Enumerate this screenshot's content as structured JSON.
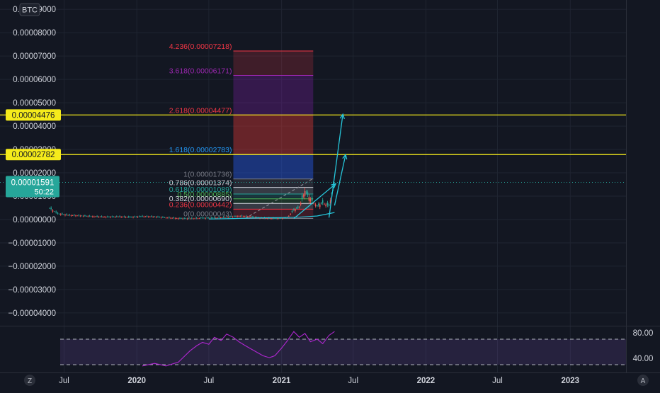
{
  "symbol_badge": "BTC",
  "theme": {
    "background": "#131722",
    "grid": "#1f2431",
    "axis_text": "#d1d4dc",
    "badge_yellow": "#f5eb1b",
    "badge_teal": "#26a69a",
    "rsi_purple": "#b026d1",
    "rsi_band": "#7e57c2",
    "projection": "#26c6da",
    "candle_up": "#26a69a",
    "candle_down": "#ef5350"
  },
  "price_axis": {
    "ticks": [
      "0.00009000",
      "0.00008000",
      "0.00007000",
      "0.00006000",
      "0.00005000",
      "0.00004000",
      "0.00003000",
      "0.00002000",
      "0.00001000",
      "0.00000000",
      "−0.00001000",
      "−0.00002000",
      "−0.00003000",
      "−0.00004000"
    ],
    "tick_values": [
      9e-05,
      8e-05,
      7e-05,
      6e-05,
      5e-05,
      4e-05,
      3e-05,
      2e-05,
      1e-05,
      0,
      -1e-05,
      -2e-05,
      -3e-05,
      -4e-05
    ],
    "badges": [
      {
        "label": "0.00004476",
        "value": 4.476e-05,
        "color": "#f5eb1b",
        "text_color": "#131722"
      },
      {
        "label": "0.00002782",
        "value": 2.782e-05,
        "color": "#f5eb1b",
        "text_color": "#131722"
      }
    ],
    "last_price": {
      "label": "0.00001591",
      "countdown": "50:22",
      "value": 1.591e-05,
      "color": "#26a69a"
    }
  },
  "time_axis": {
    "labels": [
      "Jul",
      "2020",
      "Jul",
      "2021",
      "Jul",
      "2022",
      "Jul",
      "2023"
    ],
    "bold": [
      false,
      true,
      false,
      true,
      false,
      true,
      false,
      true
    ]
  },
  "fib_levels": [
    {
      "label": "4.236(0.00007218)",
      "value": 7.218e-05,
      "color": "#f23645"
    },
    {
      "label": "3.618(0.00006171)",
      "value": 6.171e-05,
      "color": "#9c27b0"
    },
    {
      "label": "2.618(0.00004477)",
      "value": 4.477e-05,
      "color": "#f23645"
    },
    {
      "label": "1.618(0.00002783)",
      "value": 2.783e-05,
      "color": "#2196f3"
    },
    {
      "label": "1(0.00001736)",
      "value": 1.736e-05,
      "color": "#787b86"
    },
    {
      "label": "0.786(0.00001374)",
      "value": 1.374e-05,
      "color": "#d1d4dc"
    },
    {
      "label": "0.618(0.00001089)",
      "value": 1.089e-05,
      "color": "#26a69a"
    },
    {
      "label": "0.5(0.00000885)",
      "value": 8.85e-06,
      "color": "#4caf50"
    },
    {
      "label": "0.382(0.00000690)",
      "value": 6.9e-06,
      "color": "#d1d4dc"
    },
    {
      "label": "0.236(0.00000442)",
      "value": 4.42e-06,
      "color": "#f23645"
    },
    {
      "label": "0(0.00000043)",
      "value": 4.3e-07,
      "color": "#787b86"
    }
  ],
  "rsi": {
    "labels": [
      "80.00",
      "40.00"
    ],
    "label_values": [
      80,
      40
    ],
    "band_upper": 70,
    "band_lower": 30
  },
  "bottom_left_button": "Z",
  "bottom_right_button": "A",
  "chart_data": {
    "type": "line",
    "title": "",
    "ylim": [
      -4.55e-05,
      9.4e-05
    ],
    "grid": true,
    "x_timeline": [
      "2019-04",
      "2019-07",
      "2019-10",
      "2020-01",
      "2020-04",
      "2020-07",
      "2020-10",
      "2021-01",
      "2021-04",
      "2021-07",
      "2021-10",
      "2022-01",
      "2022-04",
      "2022-07",
      "2022-10",
      "2023-01"
    ],
    "series": [
      {
        "x": [
          "2019-05-25",
          "2019-06-15",
          "2019-07-15",
          "2019-08-15",
          "2019-09-15",
          "2019-10-15",
          "2019-11-15",
          "2019-12-15",
          "2020-01-15",
          "2020-02-15",
          "2020-03-15",
          "2020-04-15",
          "2020-05-15",
          "2020-06-15",
          "2020-07-15",
          "2020-08-15",
          "2020-09-15",
          "2020-10-15",
          "2020-11-15",
          "2020-12-15",
          "2021-01-15",
          "2021-02-01",
          "2021-02-15",
          "2021-03-01",
          "2021-03-15",
          "2021-04-01",
          "2021-04-15",
          "2021-05-01",
          "2021-05-15"
        ],
        "y": [
          4.9e-06,
          2.5e-06,
          1.8e-06,
          1.6e-06,
          1.3e-06,
          1.1e-06,
          1.2e-06,
          1e-06,
          1.3e-06,
          1.2e-06,
          8e-07,
          5e-07,
          4e-07,
          6e-07,
          7e-07,
          1e-06,
          1.5e-06,
          1.2e-06,
          6e-07,
          4e-07,
          7e-07,
          4e-06,
          5.4e-06,
          1.22e-05,
          8.8e-06,
          5.7e-06,
          7.1e-06,
          5.8e-06,
          1.59e-05
        ]
      },
      {
        "x": [
          "2020-07-01",
          "2020-09-01",
          "2020-11-01",
          "2021-01-01",
          "2021-02-15",
          "2021-04-01",
          "2021-05-15"
        ],
        "y": [
          2e-07,
          4e-07,
          7e-07,
          8e-07,
          1e-06,
          1.5e-06,
          3e-06
        ]
      }
    ],
    "rsi_series": {
      "x": [
        "2020-01-15",
        "2020-02-15",
        "2020-03-15",
        "2020-04-15",
        "2020-05-15",
        "2020-06-01",
        "2020-06-15",
        "2020-07-01",
        "2020-07-15",
        "2020-08-01",
        "2020-08-15",
        "2020-09-01",
        "2020-09-15",
        "2020-10-01",
        "2020-10-15",
        "2020-11-01",
        "2020-11-15",
        "2020-12-01",
        "2020-12-15",
        "2021-01-01",
        "2021-01-15",
        "2021-02-01",
        "2021-02-15",
        "2021-03-01",
        "2021-03-15",
        "2021-04-01",
        "2021-04-15",
        "2021-05-01",
        "2021-05-15"
      ],
      "y": [
        28,
        32,
        28,
        34,
        52,
        60,
        65,
        62,
        73,
        68,
        78,
        73,
        66,
        60,
        55,
        49,
        44,
        41,
        44,
        56,
        67,
        82,
        73,
        79,
        66,
        70,
        63,
        76,
        82
      ]
    },
    "projections": [
      {
        "from": [
          "2021-02-01",
          4e-07
        ],
        "to": [
          "2021-05-18",
          1.53e-05
        ]
      },
      {
        "from": [
          "2021-05-01",
          8e-07
        ],
        "to": [
          "2021-06-05",
          4.51e-05
        ]
      },
      {
        "from": [
          "2021-05-15",
          6e-06
        ],
        "to": [
          "2021-06-12",
          2.78e-05
        ]
      }
    ],
    "fib_box": {
      "x_start": "2020-09-01",
      "x_end": "2021-03-22"
    }
  }
}
